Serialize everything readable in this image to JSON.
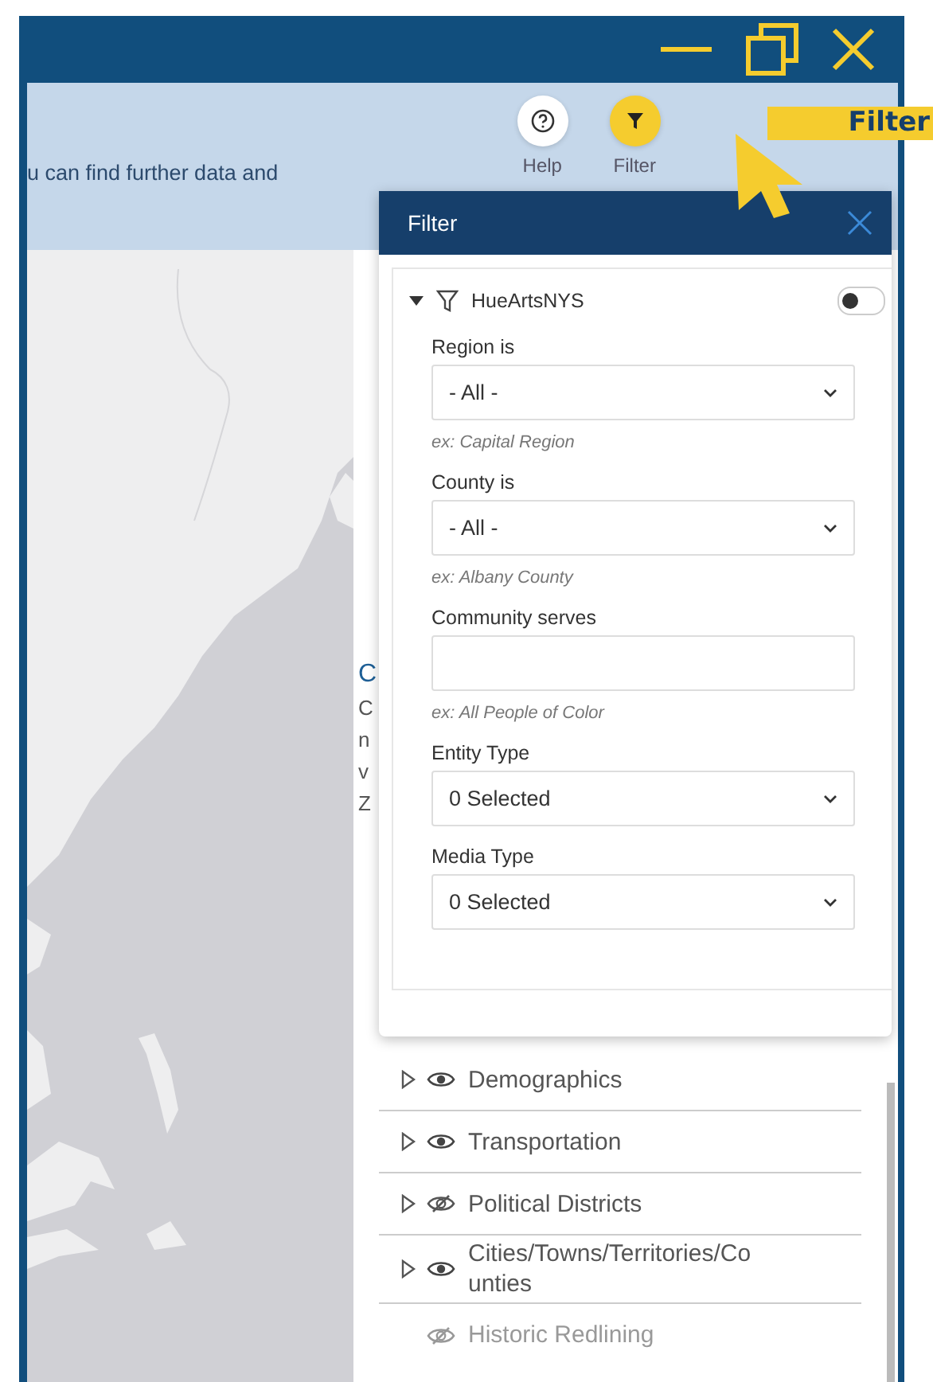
{
  "callout": {
    "label": "Filter"
  },
  "header": {
    "intro": "u can find further data and",
    "actions": [
      {
        "label": "Help",
        "kind": "help",
        "selected": false
      },
      {
        "label": "Filter",
        "kind": "filter",
        "selected": true
      }
    ]
  },
  "info": {
    "heading": "C",
    "lines": [
      "C",
      "n",
      "v",
      "Z"
    ]
  },
  "layers": [
    {
      "label": "Demographics",
      "expandable": true,
      "visible": true,
      "disabled": false
    },
    {
      "label": "Transportation",
      "expandable": true,
      "visible": true,
      "disabled": false
    },
    {
      "label": "Political Districts",
      "expandable": true,
      "visible": false,
      "disabled": false
    },
    {
      "label": "Cities/Towns/Territories/Co unties",
      "expandable": true,
      "visible": true,
      "disabled": false
    },
    {
      "label": "Historic Redlining",
      "expandable": false,
      "visible": false,
      "disabled": true
    }
  ],
  "filter_panel": {
    "title": "Filter",
    "group": {
      "name": "HueArtsNYS",
      "expanded": true,
      "on": false
    },
    "fields": [
      {
        "kind": "select",
        "label": "Region is",
        "value": "- All -",
        "hint": "ex: Capital Region"
      },
      {
        "kind": "select",
        "label": "County is",
        "value": "- All -",
        "hint": "ex: Albany County"
      },
      {
        "kind": "text",
        "label": "Community serves",
        "hint": "ex: All People of Color"
      },
      {
        "kind": "select",
        "label": "Entity Type",
        "value": "0 Selected"
      },
      {
        "kind": "select",
        "label": "Media Type",
        "value": "0 Selected"
      }
    ]
  }
}
